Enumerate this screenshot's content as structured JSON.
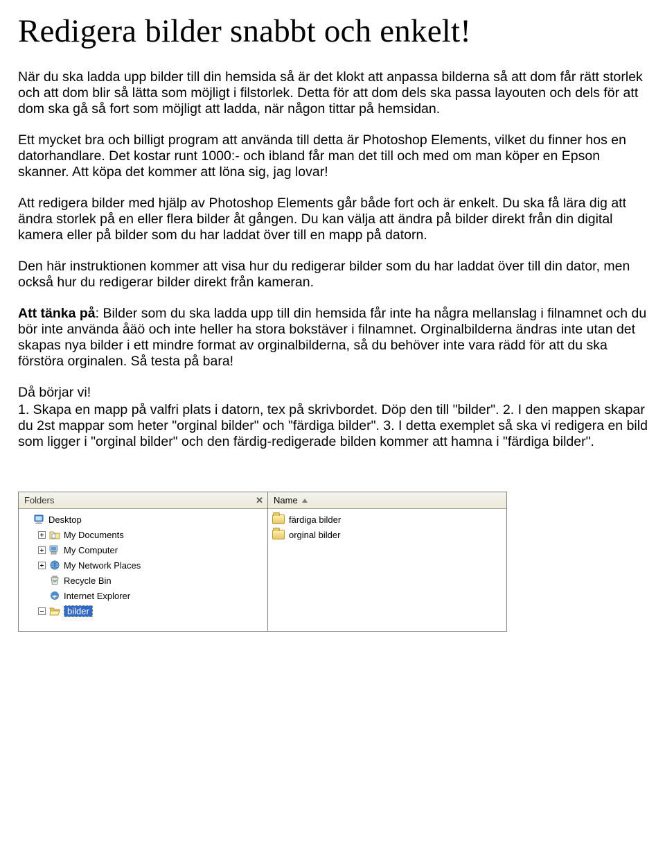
{
  "title": "Redigera bilder snabbt och enkelt!",
  "p1": "När du ska ladda upp bilder till din hemsida så är det klokt att anpassa bilderna så att dom får rätt storlek och att dom blir så lätta som möjligt i filstorlek. Detta för att dom dels ska passa layouten och dels för att dom ska gå så fort som möjligt att ladda, när någon tittar på hemsidan.",
  "p2": "Ett mycket bra och billigt program att använda till detta är Photoshop Elements, vilket du finner hos en datorhandlare. Det kostar runt 1000:- och ibland får man det till och med om man köper en Epson skanner. Att köpa det kommer att löna sig, jag lovar!",
  "p3": "Att redigera bilder med hjälp av Photoshop Elements går både fort och är enkelt. Du ska få lära dig att ändra storlek på en eller flera bilder åt gången. Du kan välja att ändra på bilder direkt från din digital kamera eller på bilder som du har laddat över till en mapp på datorn.",
  "p4": "Den här instruktionen kommer att visa hur du redigerar bilder som du har laddat över till din dator, men också hur du redigerar bilder direkt från kameran.",
  "p5_lead": "Att tänka på",
  "p5_rest_line1": ": Bilder som du ska ladda upp till din hemsida får inte ha några mellanslag",
  "p5_rest_more": "i filnamnet och du bör inte använda åäö och inte heller ha stora bokstäver i filnamnet. Orginalbilderna ändras inte utan det skapas nya bilder i ett mindre format av orginalbilderna, så du behöver inte vara rädd för att du ska förstöra orginalen. Så testa på bara!",
  "p6": "Då börjar vi!",
  "p7": "1. Skapa en mapp på valfri plats i datorn, tex på skrivbordet. Döp den till \"bilder\". 2. I den mappen skapar du 2st mappar som heter \"orginal bilder\" och \"färdiga bilder\". 3. I detta exemplet så ska vi redigera en bild som ligger i  \"orginal bilder\" och den färdig-redigerade bilden kommer att hamna i \"färdiga bilder\".",
  "explorer": {
    "folders_header": "Folders",
    "name_header": "Name",
    "tree": {
      "desktop": "Desktop",
      "documents": "My Documents",
      "computer": "My Computer",
      "network": "My Network Places",
      "recycle": "Recycle Bin",
      "ie": "Internet Explorer",
      "bilder": "bilder"
    },
    "files": {
      "f1": "färdiga bilder",
      "f2": "orginal bilder"
    }
  }
}
